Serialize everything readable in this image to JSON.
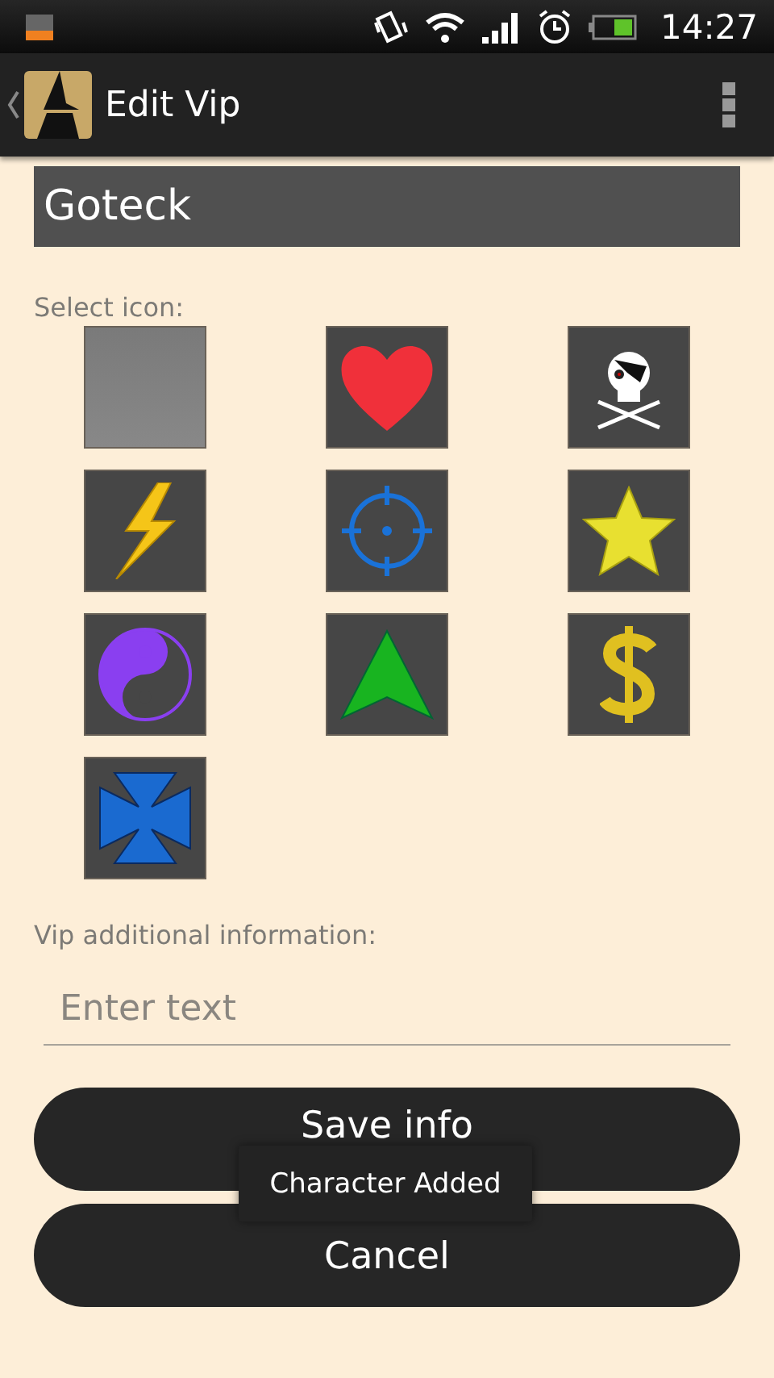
{
  "status_bar": {
    "time": "14:27"
  },
  "action_bar": {
    "title": "Edit Vip"
  },
  "name_field": {
    "value": "Goteck"
  },
  "icon_picker": {
    "label": "Select icon:",
    "icons": [
      {
        "kind": "blank"
      },
      {
        "kind": "heart"
      },
      {
        "kind": "skull"
      },
      {
        "kind": "bolt"
      },
      {
        "kind": "crosshair"
      },
      {
        "kind": "star"
      },
      {
        "kind": "yinyang"
      },
      {
        "kind": "arrow"
      },
      {
        "kind": "dollar"
      },
      {
        "kind": "cross"
      }
    ]
  },
  "info_field": {
    "label": "Vip additional information:",
    "placeholder": "Enter text"
  },
  "buttons": [
    "Save info",
    "Cancel"
  ],
  "toast": "Character Added"
}
